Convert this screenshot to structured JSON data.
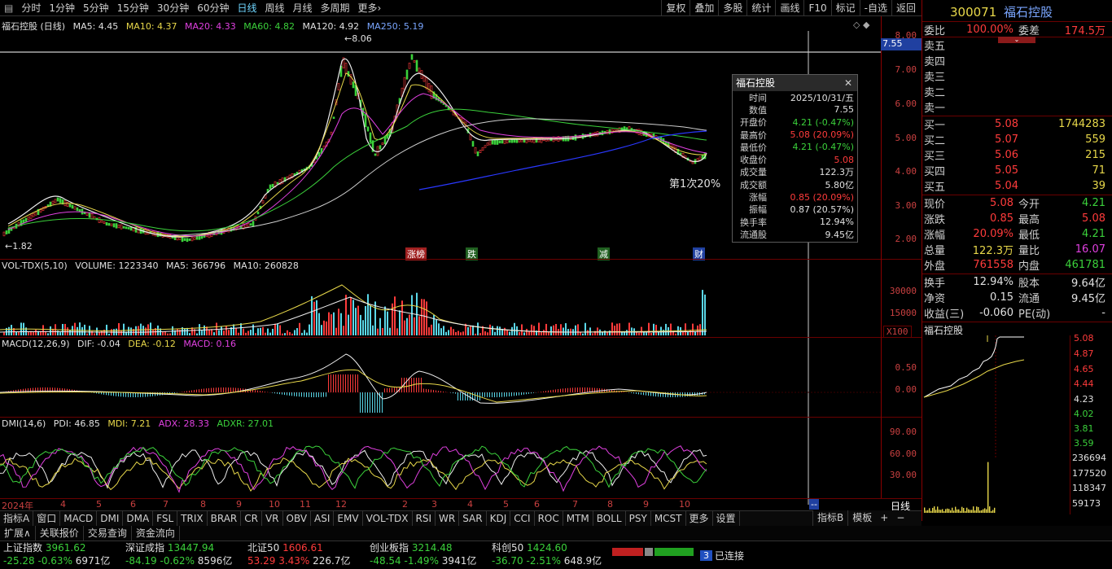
{
  "toolbar": {
    "periods": [
      "分时",
      "1分钟",
      "5分钟",
      "15分钟",
      "30分钟",
      "60分钟",
      "日线",
      "周线",
      "月线",
      "多周期",
      "更多›"
    ],
    "active": "日线",
    "right": [
      "复权",
      "叠加",
      "多股",
      "统计",
      "画线",
      "F10",
      "标记",
      "-自选",
      "返回"
    ]
  },
  "stock": {
    "code": "300071",
    "name": "福石控股",
    "period": "日线"
  },
  "ma_line": {
    "title": "福石控股 (日线)",
    "ma5": "MA5: 4.45",
    "ma10": "MA10: 4.37",
    "ma20": "MA20: 4.33",
    "ma60": "MA60: 4.82",
    "ma120": "MA120: 4.92",
    "ma250": "MA250: 5.19"
  },
  "price_axis": [
    "8.00",
    "7.00",
    "6.00",
    "5.00",
    "4.00",
    "3.00",
    "2.00"
  ],
  "crosshair_price": "7.55",
  "annotations": {
    "high": "8.06",
    "low": "1.82",
    "note": "第1次20%"
  },
  "events": [
    "涨榜",
    "跌",
    "减",
    "财"
  ],
  "vol": {
    "label": "VOL-TDX(5,10)",
    "volume": "VOLUME: 1223340",
    "ma5": "MA5: 366796",
    "ma10": "MA10: 260828",
    "axis": [
      "30000",
      "15000"
    ],
    "unit": "X100"
  },
  "macd": {
    "label": "MACD(12,26,9)",
    "dif": "DIF: -0.04",
    "dea": "DEA: -0.12",
    "macd": "MACD: 0.16",
    "axis": [
      "0.50",
      "0.00"
    ]
  },
  "dmi": {
    "label": "DMI(14,6)",
    "pdi": "PDI: 46.85",
    "mdi": "MDI: 7.21",
    "adx": "ADX: 28.33",
    "adxr": "ADXR: 27.01",
    "axis": [
      "90.00",
      "60.00",
      "30.00"
    ]
  },
  "time_axis": {
    "year": "2024年",
    "months": [
      "4",
      "5",
      "6",
      "7",
      "8",
      "9",
      "10",
      "11",
      "12",
      "2",
      "3",
      "4",
      "5",
      "6",
      "7",
      "8",
      "9",
      "10"
    ],
    "mode": "日线",
    "marker": "--"
  },
  "popup": {
    "title": "福石控股",
    "rows": [
      {
        "k": "时间",
        "v": "2025/10/31/五",
        "c": "white"
      },
      {
        "k": "数值",
        "v": "7.55",
        "c": "white"
      },
      {
        "k": "开盘价",
        "v": "4.21 (-0.47%)",
        "c": "green"
      },
      {
        "k": "最高价",
        "v": "5.08 (20.09%)",
        "c": "red"
      },
      {
        "k": "最低价",
        "v": "4.21 (-0.47%)",
        "c": "green"
      },
      {
        "k": "收盘价",
        "v": "5.08",
        "c": "red"
      },
      {
        "k": "成交量",
        "v": "122.3万",
        "c": "white"
      },
      {
        "k": "成交额",
        "v": "5.80亿",
        "c": "white"
      },
      {
        "k": "涨幅",
        "v": "0.85 (20.09%)",
        "c": "red"
      },
      {
        "k": "振幅",
        "v": "0.87 (20.57%)",
        "c": "white"
      },
      {
        "k": "换手率",
        "v": "12.94%",
        "c": "white"
      },
      {
        "k": "流通股",
        "v": "9.45亿",
        "c": "white"
      }
    ]
  },
  "quote": {
    "weibi_k": "委比",
    "weibi": "100.00%",
    "weicha_k": "委差",
    "weicha": "174.5万",
    "sell": [
      {
        "k": "卖五"
      },
      {
        "k": "卖四"
      },
      {
        "k": "卖三"
      },
      {
        "k": "卖二"
      },
      {
        "k": "卖一"
      }
    ],
    "buy": [
      {
        "k": "买一",
        "p": "5.08",
        "q": "1744283"
      },
      {
        "k": "买二",
        "p": "5.07",
        "q": "559"
      },
      {
        "k": "买三",
        "p": "5.06",
        "q": "215"
      },
      {
        "k": "买四",
        "p": "5.05",
        "q": "71"
      },
      {
        "k": "买五",
        "p": "5.04",
        "q": "39"
      }
    ],
    "stats": [
      {
        "k1": "现价",
        "v1": "5.08",
        "c1": "red",
        "k2": "今开",
        "v2": "4.21",
        "c2": "green"
      },
      {
        "k1": "涨跌",
        "v1": "0.85",
        "c1": "red",
        "k2": "最高",
        "v2": "5.08",
        "c2": "red"
      },
      {
        "k1": "涨幅",
        "v1": "20.09%",
        "c1": "red",
        "k2": "最低",
        "v2": "4.21",
        "c2": "green"
      },
      {
        "k1": "总量",
        "v1": "122.3万",
        "c1": "yellow",
        "k2": "量比",
        "v2": "16.07",
        "c2": "mag"
      },
      {
        "k1": "外盘",
        "v1": "761558",
        "c1": "red",
        "k2": "内盘",
        "v2": "461781",
        "c2": "green"
      }
    ],
    "stats2": [
      {
        "k1": "换手",
        "v1": "12.94%",
        "k2": "股本",
        "v2": "9.64亿"
      },
      {
        "k1": "净资",
        "v1": "0.15",
        "k2": "流通",
        "v2": "9.45亿"
      },
      {
        "k1": "收益(三)",
        "v1": "-0.060",
        "k2": "PE(动)",
        "v2": "-"
      }
    ],
    "mini_title": "福石控股",
    "mini_axis": [
      "5.08",
      "4.87",
      "4.65",
      "4.44",
      "4.23",
      "4.02",
      "3.81",
      "3.59"
    ],
    "mini_vol": [
      "236694",
      "177520",
      "118347",
      "59173"
    ]
  },
  "bottom_tabs": [
    "指标A",
    "窗口",
    "MACD",
    "DMI",
    "DMA",
    "FSL",
    "TRIX",
    "BRAR",
    "CR",
    "VR",
    "OBV",
    "ASI",
    "EMV",
    "VOL-TDX",
    "RSI",
    "WR",
    "SAR",
    "KDJ",
    "CCI",
    "ROC",
    "MTM",
    "BOLL",
    "PSY",
    "MCST",
    "更多",
    "设置"
  ],
  "bottom_right": [
    "指标B",
    "模板",
    "+",
    "−"
  ],
  "sub_tabs": [
    "扩展∧",
    "关联报价",
    "交易查询",
    "资金流向"
  ],
  "indices": [
    {
      "name": "上证指数",
      "val": "3961.62",
      "chg": "-25.28",
      "pct": "-0.63%",
      "amt": "6971亿",
      "c": "green"
    },
    {
      "name": "深证成指",
      "val": "13447.94",
      "chg": "-84.19",
      "pct": "-0.62%",
      "amt": "8596亿",
      "c": "green"
    },
    {
      "name": "北证50",
      "val": "1606.61",
      "chg": "53.29",
      "pct": "3.43%",
      "amt": "226.7亿",
      "c": "red"
    },
    {
      "name": "创业板指",
      "val": "3214.48",
      "chg": "-48.54",
      "pct": "-1.49%",
      "amt": "3941亿",
      "c": "green"
    },
    {
      "name": "科创50",
      "val": "1424.60",
      "chg": "-36.70",
      "pct": "-2.51%",
      "amt": "648.9亿",
      "c": "green"
    }
  ],
  "connection": {
    "count": "3",
    "text": "已连接"
  }
}
